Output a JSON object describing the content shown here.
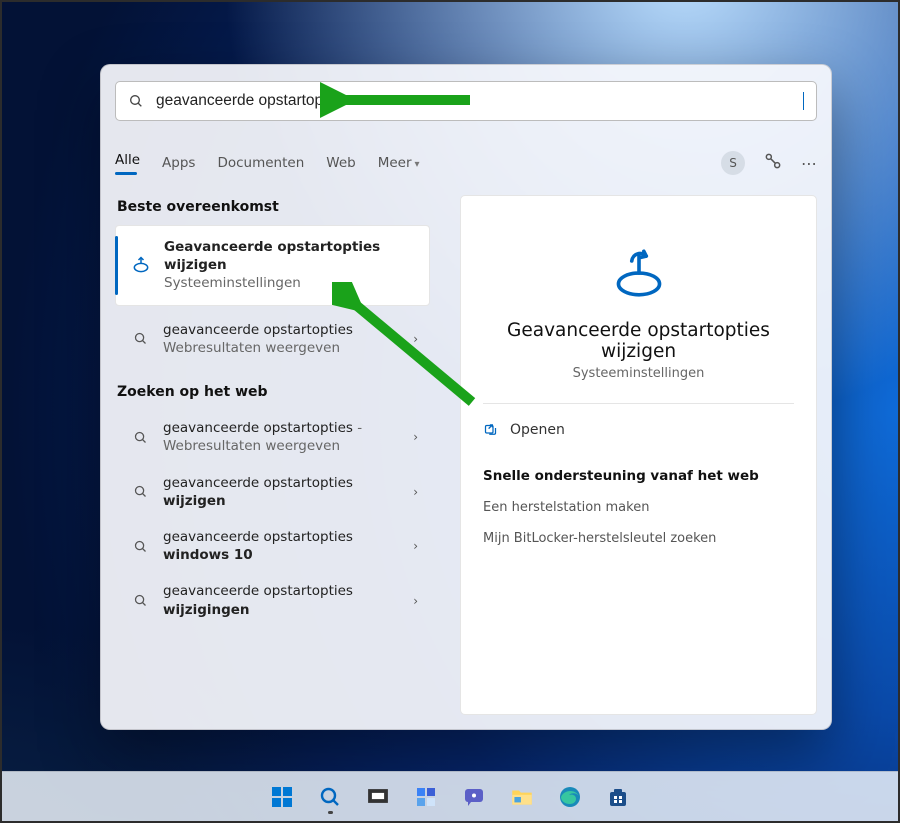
{
  "search": {
    "value": "geavanceerde opstartopties w"
  },
  "tabs": {
    "all": "Alle",
    "apps": "Apps",
    "documents": "Documenten",
    "web": "Web",
    "more": "Meer"
  },
  "accountInitial": "S",
  "sections": {
    "bestMatch": "Beste overeenkomst",
    "webSearch": "Zoeken op het web"
  },
  "bestResult": {
    "title": "Geavanceerde opstartopties wijzigen",
    "subtitle": "Systeeminstellingen"
  },
  "resultSuggest": {
    "title": "geavanceerde opstartopties",
    "sub": "Webresultaten weergeven"
  },
  "webResults": [
    {
      "pre": "geavanceerde opstartopties",
      "post": " - Webresultaten weergeven"
    },
    {
      "pre": "geavanceerde opstartopties ",
      "bold": "wijzigen"
    },
    {
      "pre": "geavanceerde opstartopties ",
      "bold": "windows 10"
    },
    {
      "pre": "geavanceerde opstartopties ",
      "bold": "wijzigingen"
    }
  ],
  "detail": {
    "title": "Geavanceerde opstartopties wijzigen",
    "subtitle": "Systeeminstellingen",
    "open": "Openen",
    "quickHead": "Snelle ondersteuning vanaf het web",
    "quick1": "Een herstelstation maken",
    "quick2": "Mijn BitLocker-herstelsleutel zoeken"
  },
  "colors": {
    "accent": "#0067c0"
  }
}
